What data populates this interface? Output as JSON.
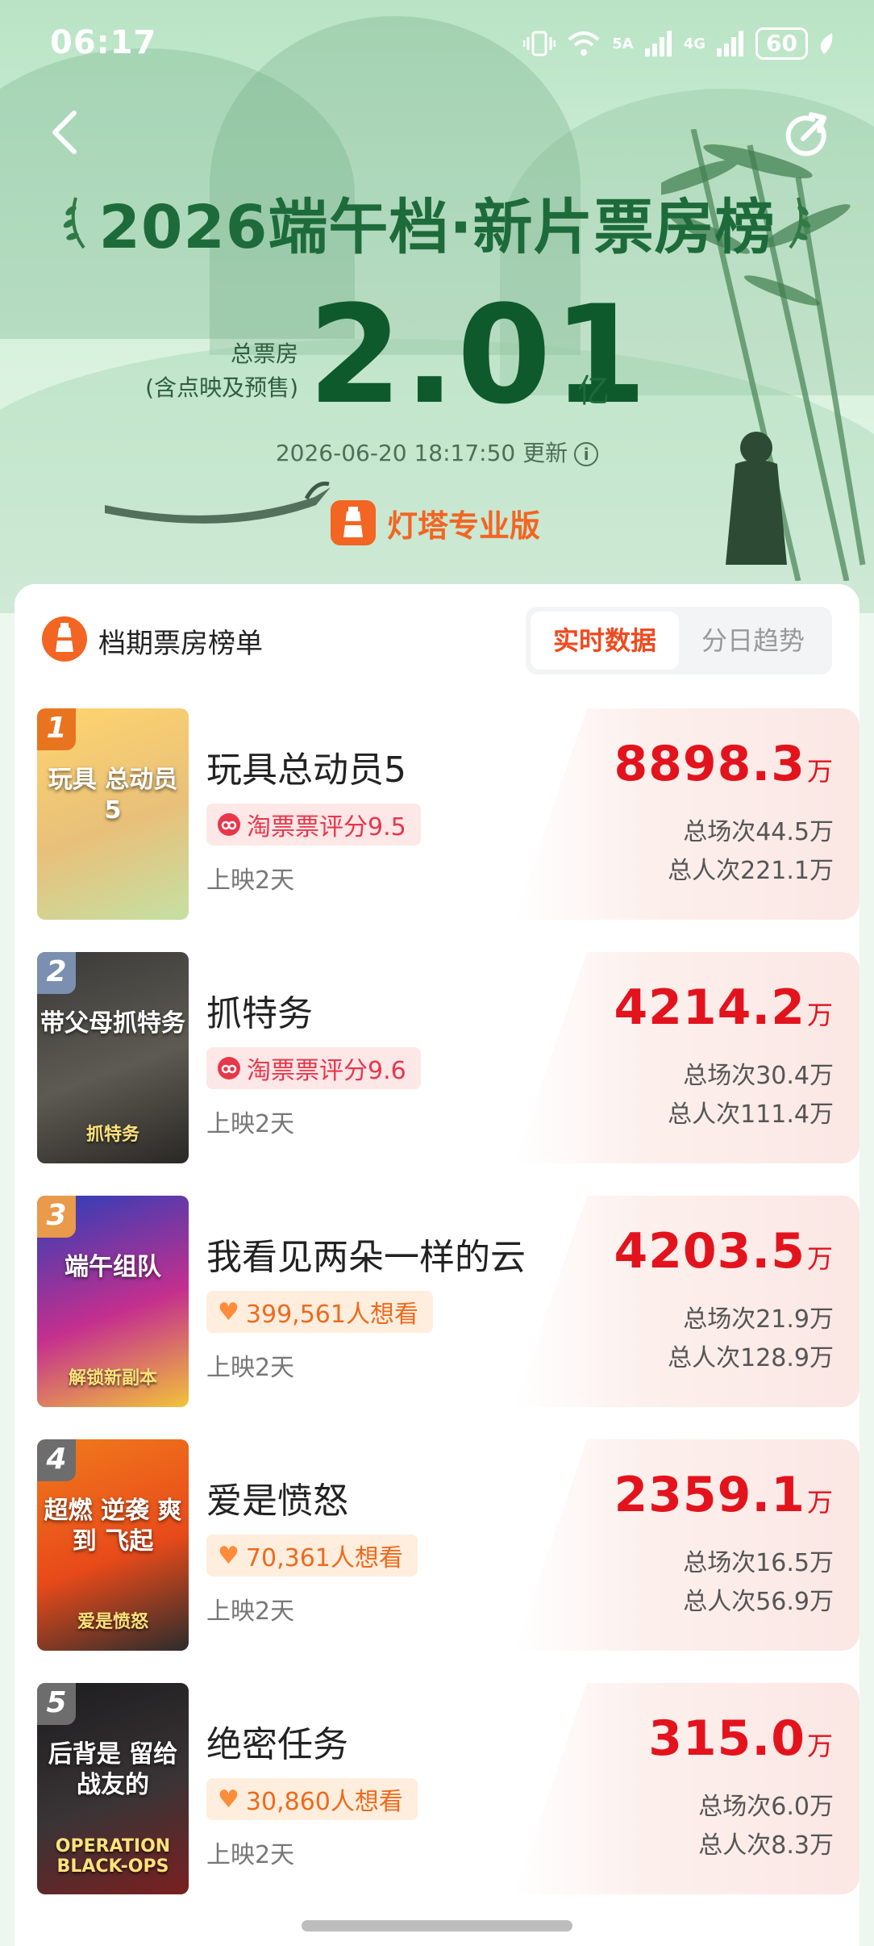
{
  "status_bar": {
    "time": "06:17",
    "icons": [
      "vibrate-icon",
      "wifi-icon",
      "5g-signal-icon",
      "4g-signal-icon",
      "battery-icon"
    ],
    "signal_5g": "5A",
    "signal_4g": "4G",
    "battery": "60"
  },
  "header": {
    "title": "2026端午档·新片票房榜",
    "total_label_1": "总票房",
    "total_label_2": "(含点映及预售)",
    "total_value": "2.01",
    "total_unit": "亿",
    "updated": "2026-06-20 18:17:50 更新",
    "brand": "灯塔专业版"
  },
  "list": {
    "title": "档期票房榜单",
    "tabs": [
      {
        "label": "实时数据",
        "active": true
      },
      {
        "label": "分日趋势",
        "active": false
      }
    ],
    "movies": [
      {
        "rank": "1",
        "name": "玩具总动员5",
        "tag": "淘票票评分9.5",
        "tag_type": "rating",
        "days": "上映2天",
        "amount": "8898.3",
        "unit": "万",
        "screenings": "总场次44.5万",
        "audience": "总人次221.1万",
        "rank_color": "#e9741f",
        "poster_colors": [
          "#ffd46e",
          "#e8c07a",
          "#c5e0a3"
        ]
      },
      {
        "rank": "2",
        "name": "抓特务",
        "tag": "淘票票评分9.6",
        "tag_type": "rating",
        "days": "上映2天",
        "amount": "4214.2",
        "unit": "万",
        "screenings": "总场次30.4万",
        "audience": "总人次111.4万",
        "rank_color": "#7b8fb0",
        "poster_colors": [
          "#3a3a38",
          "#5d5a52",
          "#2a2825"
        ]
      },
      {
        "rank": "3",
        "name": "我看见两朵一样的云",
        "tag": "399,561人想看",
        "tag_type": "want",
        "days": "上映2天",
        "amount": "4203.5",
        "unit": "万",
        "screenings": "总场次21.9万",
        "audience": "总人次128.9万",
        "rank_color": "#e99a4a",
        "poster_colors": [
          "#2b3fb8",
          "#c42f8e",
          "#f2c23a"
        ]
      },
      {
        "rank": "4",
        "name": "爱是愤怒",
        "tag": "70,361人想看",
        "tag_type": "want",
        "days": "上映2天",
        "amount": "2359.1",
        "unit": "万",
        "screenings": "总场次16.5万",
        "audience": "总人次56.9万",
        "rank_color": "#6d6d6d",
        "poster_colors": [
          "#f07a1c",
          "#e84a1a",
          "#2c2c2c"
        ]
      },
      {
        "rank": "5",
        "name": "绝密任务",
        "tag": "30,860人想看",
        "tag_type": "want",
        "days": "上映2天",
        "amount": "315.0",
        "unit": "万",
        "screenings": "总场次6.0万",
        "audience": "总人次8.3万",
        "rank_color": "#6d6d6d",
        "poster_colors": [
          "#1c1c1e",
          "#3a3436",
          "#7a1f1f"
        ]
      }
    ]
  },
  "posters": {
    "p1_text": "玩具 总动员 5",
    "p2_text": "带父母抓特务",
    "p2_sub": "抓特务",
    "p3_text": "端午组队",
    "p3_sub": "解锁新副本",
    "p4_text": "超燃 逆袭 爽到 飞起",
    "p4_sub": "爱是愤怒",
    "p5_text": "后背是 留给战友的",
    "p5_sub": "OPERATION BLACK-OPS"
  }
}
